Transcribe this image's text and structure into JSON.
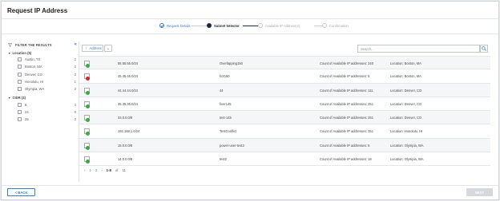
{
  "page": {
    "title": "Request IP Address"
  },
  "stepper": {
    "steps": [
      {
        "label": "Request Details",
        "state": "done"
      },
      {
        "label": "Subnet Selector",
        "state": "active"
      },
      {
        "label": "Available IP Address(s)",
        "state": "pending"
      },
      {
        "label": "Confirmation",
        "state": "pending"
      }
    ]
  },
  "filter": {
    "title": "FILTER THE RESULTS",
    "collapse_icon": "double-chevron-left-icon",
    "groups": [
      {
        "title": "Location (5)",
        "items": [
          {
            "label": "Austin, TX",
            "count": "2"
          },
          {
            "label": "Boston, MA",
            "count": "2"
          },
          {
            "label": "Denver, CO",
            "count": "2"
          },
          {
            "label": "Honolulu, HI",
            "count": "1"
          },
          {
            "label": "Olympia, WA",
            "count": "2"
          }
        ]
      },
      {
        "title": "CIDR (3)",
        "items": [
          {
            "label": "8",
            "count": "3"
          },
          {
            "label": "24",
            "count": "6"
          },
          {
            "label": "25",
            "count": "2"
          }
        ]
      }
    ]
  },
  "toolbar": {
    "sort_label": "Address",
    "sort_icon": "arrow-up-icon",
    "dropdown_icon": "chevron-down-icon",
    "search_placeholder": "Search...",
    "search_icon": "search-icon"
  },
  "colors": {
    "status_green": "#3aa845",
    "status_red": "#d0262b",
    "accent": "#3a7fc1"
  },
  "table": {
    "rows": [
      {
        "status": "green",
        "address": "55.55.55.0/24",
        "name": "Overlapping150",
        "available": "Count of Available IP addresses: 240",
        "location": "Location: Boston, MA"
      },
      {
        "status": "red",
        "address": "45.45.45.0/24",
        "name": "hot150",
        "available": "Count of Available IP addresses: 5",
        "location": "Location: Boston, MA"
      },
      {
        "status": "green",
        "address": "44.44.44.0/24",
        "name": "44",
        "available": "Count of Available IP addresses: 111",
        "location": "Location: Denver, CO"
      },
      {
        "status": "green",
        "address": "35.35.35.0/24",
        "name": "fiver145",
        "available": "Count of Available IP addresses: 251",
        "location": "Location: Denver, CO"
      },
      {
        "status": "green",
        "address": "33.0.0.0/8",
        "name": "test-145",
        "available": "Count of Available IP addresses: 251",
        "location": "Location: Denver, CO"
      },
      {
        "status": "green",
        "address": "192.168.1.0/24",
        "name": "TestConflict",
        "available": "Count of Available IP addresses: 251",
        "location": "Location: Honolulu, HI"
      },
      {
        "status": "green",
        "address": "15.0.0.0/8",
        "name": "power-user-test3",
        "available": "Count of Available IP addresses: 5",
        "location": "Location: Olympia, WA"
      },
      {
        "status": "green",
        "address": "14.0.0.0/8",
        "name": "test2",
        "available": "Count of Available IP addresses: 18",
        "location": "Location: Olympia, WA"
      }
    ]
  },
  "pagination": {
    "prev": "‹",
    "page1": "1",
    "page2": "2",
    "next": "›",
    "range": "1-8",
    "of": "of",
    "total": "11"
  },
  "footer": {
    "back_label": "< BACK",
    "next_label": "NEXT"
  }
}
